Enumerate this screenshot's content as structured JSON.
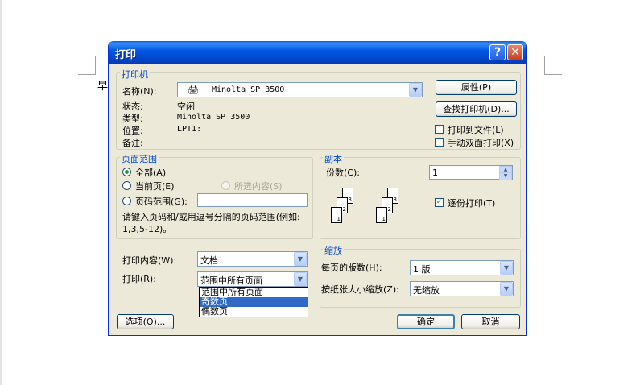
{
  "document": {
    "char": "早"
  },
  "dialog": {
    "title": "打印",
    "help_glyph": "?",
    "close_glyph": "✕",
    "printer": {
      "legend": "打印机",
      "name_label": "名称(N):",
      "name_value": "Minolta SP 3500",
      "properties_btn": "属性(P)",
      "find_btn": "查找打印机(D)...",
      "status_label": "状态:",
      "status_value": "空闲",
      "type_label": "类型:",
      "type_value": "Minolta SP 3500",
      "location_label": "位置:",
      "location_value": "LPT1:",
      "comment_label": "备注:",
      "print_to_file": "打印到文件(L)",
      "print_to_file_checked": false,
      "manual_duplex": "手动双面打印(X)",
      "manual_duplex_checked": false
    },
    "page_range": {
      "legend": "页面范围",
      "all": "全部(A)",
      "current": "当前页(E)",
      "selection": "所选内容(S)",
      "pages": "页码范围(G):",
      "selected": "all",
      "pages_value": "",
      "hint": "请键入页码和/或用逗号分隔的页码范围(例如: 1,3,5-12)。"
    },
    "copies": {
      "legend": "副本",
      "count_label": "份数(C):",
      "count_value": "1",
      "collate": "逐份打印(T)",
      "collate_checked": true,
      "page_numbers": [
        "1",
        "2",
        "3"
      ]
    },
    "print_what": {
      "label": "打印内容(W):",
      "value": "文档"
    },
    "print": {
      "label": "打印(R):",
      "value": "范围中所有页面",
      "options": [
        "范围中所有页面",
        "奇数页",
        "偶数页"
      ],
      "highlighted_index": 1
    },
    "zoom": {
      "legend": "缩放",
      "pages_per_sheet_label": "每页的版数(H):",
      "pages_per_sheet_value": "1 版",
      "scale_label": "按纸张大小缩放(Z):",
      "scale_value": "无缩放"
    },
    "options_btn": "选项(O)...",
    "ok_btn": "确定",
    "cancel_btn": "取消",
    "colors": {
      "title_bar": "#0055e5",
      "face": "#ece9d8",
      "legend": "#0046d5",
      "highlight": "#316ac5"
    }
  }
}
